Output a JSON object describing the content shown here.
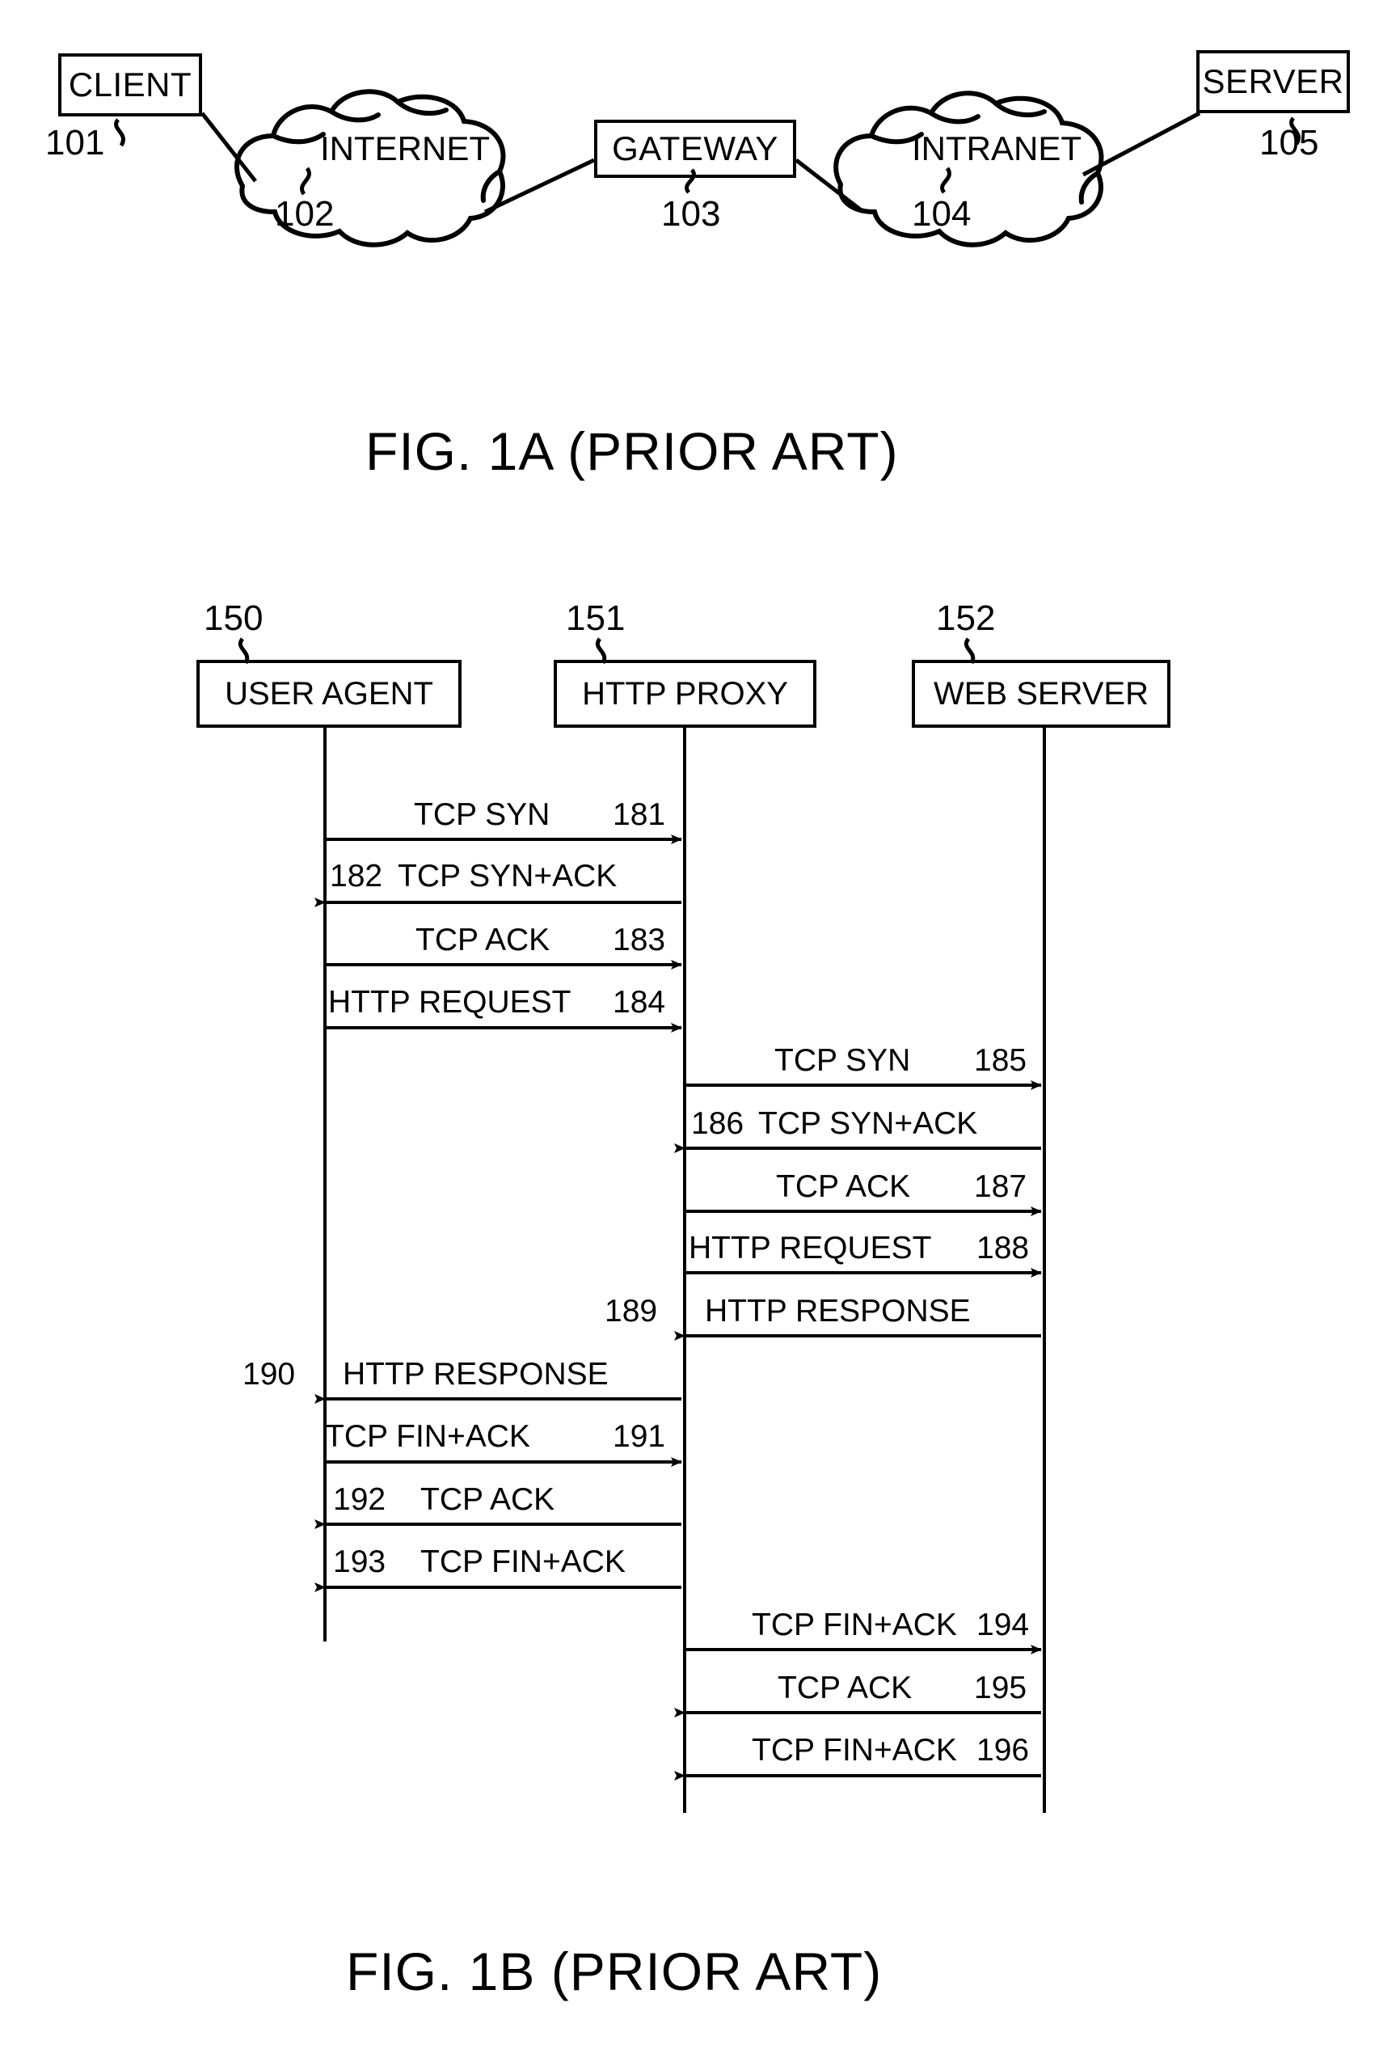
{
  "document": {
    "type": "patent-figure-sheet"
  },
  "fig1a": {
    "caption": "FIG. 1A (PRIOR ART)",
    "nodes": [
      {
        "label": "CLIENT",
        "ref": "101"
      },
      {
        "label": "INTERNET",
        "ref": "102"
      },
      {
        "label": "GATEWAY",
        "ref": "103"
      },
      {
        "label": "INTRANET",
        "ref": "104"
      },
      {
        "label": "SERVER",
        "ref": "105"
      }
    ]
  },
  "fig1b": {
    "caption": "FIG. 1B  (PRIOR ART)",
    "actors": [
      {
        "label": "USER AGENT",
        "ref": "150"
      },
      {
        "label": "HTTP PROXY",
        "ref": "151"
      },
      {
        "label": "WEB SERVER",
        "ref": "152"
      }
    ],
    "messages": [
      {
        "ref": "181",
        "label": "TCP SYN",
        "from": "USER AGENT",
        "to": "HTTP PROXY",
        "direction": "right",
        "ref_side": "right"
      },
      {
        "ref": "182",
        "label": "TCP SYN+ACK",
        "from": "HTTP PROXY",
        "to": "USER AGENT",
        "direction": "left",
        "ref_side": "inline-left"
      },
      {
        "ref": "183",
        "label": "TCP ACK",
        "from": "USER AGENT",
        "to": "HTTP PROXY",
        "direction": "right",
        "ref_side": "right"
      },
      {
        "ref": "184",
        "label": "HTTP REQUEST",
        "from": "USER AGENT",
        "to": "HTTP PROXY",
        "direction": "right",
        "ref_side": "inline-right"
      },
      {
        "ref": "185",
        "label": "TCP SYN",
        "from": "HTTP PROXY",
        "to": "WEB SERVER",
        "direction": "right",
        "ref_side": "right"
      },
      {
        "ref": "186",
        "label": "TCP SYN+ACK",
        "from": "WEB SERVER",
        "to": "HTTP PROXY",
        "direction": "left",
        "ref_side": "inline-left"
      },
      {
        "ref": "187",
        "label": "TCP ACK",
        "from": "HTTP PROXY",
        "to": "WEB SERVER",
        "direction": "right",
        "ref_side": "right"
      },
      {
        "ref": "188",
        "label": "HTTP REQUEST",
        "from": "HTTP PROXY",
        "to": "WEB SERVER",
        "direction": "right",
        "ref_side": "inline-right"
      },
      {
        "ref": "189",
        "label": "HTTP RESPONSE",
        "from": "WEB SERVER",
        "to": "HTTP PROXY",
        "direction": "left",
        "ref_side": "outside-left"
      },
      {
        "ref": "190",
        "label": "HTTP RESPONSE",
        "from": "HTTP PROXY",
        "to": "USER AGENT",
        "direction": "left",
        "ref_side": "outside-left"
      },
      {
        "ref": "191",
        "label": "TCP FIN+ACK",
        "from": "USER AGENT",
        "to": "HTTP PROXY",
        "direction": "right",
        "ref_side": "right"
      },
      {
        "ref": "192",
        "label": "TCP ACK",
        "from": "HTTP PROXY",
        "to": "USER AGENT",
        "direction": "left",
        "ref_side": "inline-left"
      },
      {
        "ref": "193",
        "label": "TCP FIN+ACK",
        "from": "HTTP PROXY",
        "to": "USER AGENT",
        "direction": "left",
        "ref_side": "inline-left"
      },
      {
        "ref": "194",
        "label": "TCP FIN+ACK",
        "from": "HTTP PROXY",
        "to": "WEB SERVER",
        "direction": "right",
        "ref_side": "inline-right"
      },
      {
        "ref": "195",
        "label": "TCP ACK",
        "from": "WEB SERVER",
        "to": "HTTP PROXY",
        "direction": "left",
        "ref_side": "right"
      },
      {
        "ref": "196",
        "label": "TCP FIN+ACK",
        "from": "WEB SERVER",
        "to": "HTTP PROXY",
        "direction": "left",
        "ref_side": "inline-right"
      }
    ]
  }
}
